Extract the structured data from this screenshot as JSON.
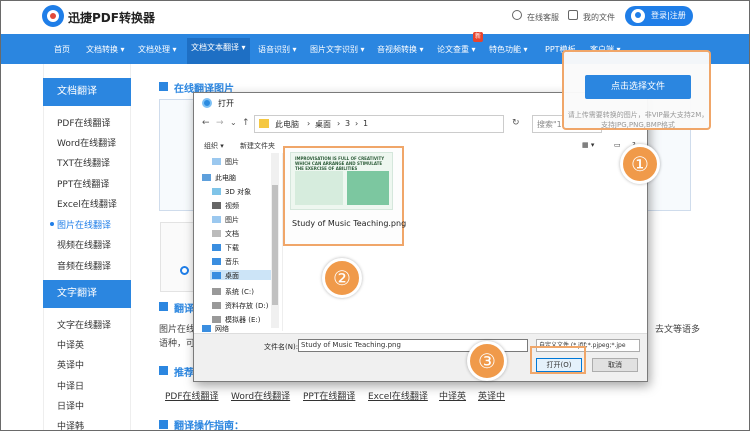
{
  "header": {
    "brand": "迅捷PDF转换器",
    "service": "在线客服",
    "my_files": "我的文件",
    "login": "登录|注册"
  },
  "nav": {
    "items": [
      "首页",
      "文档转换 ▾",
      "文档处理 ▾",
      "文档文本翻译 ▾",
      "语音识别 ▾",
      "图片文字识别 ▾",
      "音视频转换 ▾",
      "论文查重 ▾",
      "特色功能 ▾",
      "PPT模板",
      "客户端 ▾"
    ],
    "new_badge": "新"
  },
  "sidebar": {
    "doc_head": "文档翻译",
    "doc_items": [
      "PDF在线翻译",
      "Word在线翻译",
      "TXT在线翻译",
      "PPT在线翻译",
      "Excel在线翻译",
      "图片在线翻译",
      "视频在线翻译",
      "音频在线翻译"
    ],
    "text_head": "文字翻译",
    "text_items": [
      "文字在线翻译",
      "中译英",
      "英译中",
      "中译日",
      "日译中",
      "中译韩"
    ]
  },
  "main": {
    "section_title": "在线翻译图片",
    "choose_button": "点击选择文件",
    "note": "请上传需要转换的图片，非VIP最大支持2M，支持JPG,PNG,BMP格式",
    "body_line1": "图片在线",
    "body_line1_end": "去文等语多",
    "body_line2": "语种，可",
    "recommend_title": "推荐",
    "recommend_links": [
      "PDF在线翻译",
      "Word在线翻译",
      "PPT在线翻译",
      "Excel在线翻译",
      "中译英",
      "英译中"
    ],
    "guide_title": "翻译操作指南：",
    "translate_title_fragment": "翻译"
  },
  "dialog": {
    "title": "打开",
    "path": [
      "此电脑",
      "桌面",
      "3",
      "1"
    ],
    "search_placeholder": "搜索\"1\"",
    "organize": "组织 ▾",
    "new_folder": "新建文件夹",
    "tree": [
      "图片",
      "此电脑",
      "3D 对象",
      "视频",
      "图片",
      "文档",
      "下载",
      "音乐",
      "桌面",
      "系统 (C:)",
      "资料存放 (D:)",
      "模拟器 (E:)",
      "网络"
    ],
    "file_name": "Study of Music Teaching.png",
    "thumb_heading": "IMPROVISATION IS FULL OF CREATIVITY WHICH CAN ARRANGE AND STIMULATE THE EXERCISE OF ABILITIES",
    "filename_label": "文件名(N):",
    "filename_value": "Study of Music Teaching.png",
    "filetype": "自定义文件 (*.jfif;*.pjpeg;*.jpe",
    "open": "打开(O)",
    "cancel": "取消"
  },
  "steps": [
    "①",
    "②",
    "③"
  ],
  "colors": {
    "accent": "#2b86e0",
    "callout_border": "#f0a669",
    "step_circle": "#f09a4a"
  }
}
